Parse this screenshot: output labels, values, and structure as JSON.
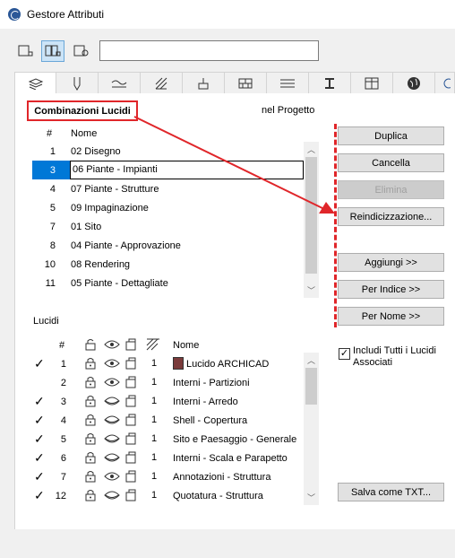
{
  "window": {
    "title": "Gestore Attributi"
  },
  "search": {
    "placeholder": ""
  },
  "header": {
    "combinazioni_label": "Combinazioni Lucidi",
    "in_progetto": "nel Progetto"
  },
  "combinazioni": {
    "col_num": "#",
    "col_name": "Nome",
    "rows": [
      {
        "num": "1",
        "name": "02 Disegno"
      },
      {
        "num": "3",
        "name": "06 Piante - Impianti"
      },
      {
        "num": "4",
        "name": "07 Piante - Strutture"
      },
      {
        "num": "5",
        "name": "09 Impaginazione"
      },
      {
        "num": "7",
        "name": "01 Sito"
      },
      {
        "num": "8",
        "name": "04 Piante - Approvazione"
      },
      {
        "num": "10",
        "name": "08 Rendering"
      },
      {
        "num": "11",
        "name": "05 Piante - Dettagliate"
      }
    ],
    "selected_index": 1
  },
  "buttons": {
    "duplica": "Duplica",
    "cancella": "Cancella",
    "elimina": "Elimina",
    "reindicizzazione": "Reindicizzazione...",
    "aggiungi": "Aggiungi >>",
    "per_indice": "Per Indice >>",
    "per_nome": "Per Nome >>",
    "salva": "Salva come TXT..."
  },
  "lucidi": {
    "title": "Lucidi",
    "col_num": "#",
    "col_name": "Nome",
    "rows": [
      {
        "checked": true,
        "num": "1",
        "pen": "1",
        "name": "Lucido ARCHICAD",
        "visible": true
      },
      {
        "checked": false,
        "num": "2",
        "pen": "1",
        "name": "Interni - Partizioni",
        "visible": true
      },
      {
        "checked": true,
        "num": "3",
        "pen": "1",
        "name": "Interni - Arredo",
        "visible": false
      },
      {
        "checked": true,
        "num": "4",
        "pen": "1",
        "name": "Shell - Copertura",
        "visible": false
      },
      {
        "checked": true,
        "num": "5",
        "pen": "1",
        "name": "Sito e Paesaggio - Generale",
        "visible": false
      },
      {
        "checked": true,
        "num": "6",
        "pen": "1",
        "name": "Interni - Scala e Parapetto",
        "visible": false
      },
      {
        "checked": true,
        "num": "7",
        "pen": "1",
        "name": "Annotazioni - Struttura",
        "visible": true
      },
      {
        "checked": true,
        "num": "12",
        "pen": "1",
        "name": "Quotatura - Struttura",
        "visible": false
      }
    ]
  },
  "includi": {
    "label": "Includi Tutti i Lucidi Associati",
    "checked": true
  },
  "colors": {
    "accent_red": "#e0262a",
    "selection": "#0078d7"
  }
}
